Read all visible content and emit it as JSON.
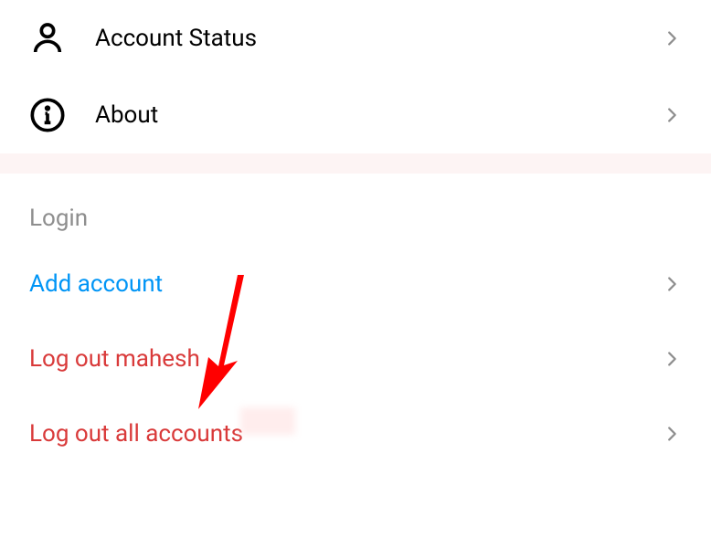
{
  "settings": {
    "account_status_label": "Account Status",
    "about_label": "About"
  },
  "login_section": {
    "header": "Login",
    "add_account_label": "Add account",
    "logout_user_label": "Log out mahesh",
    "logout_all_label": "Log out all accounts"
  }
}
